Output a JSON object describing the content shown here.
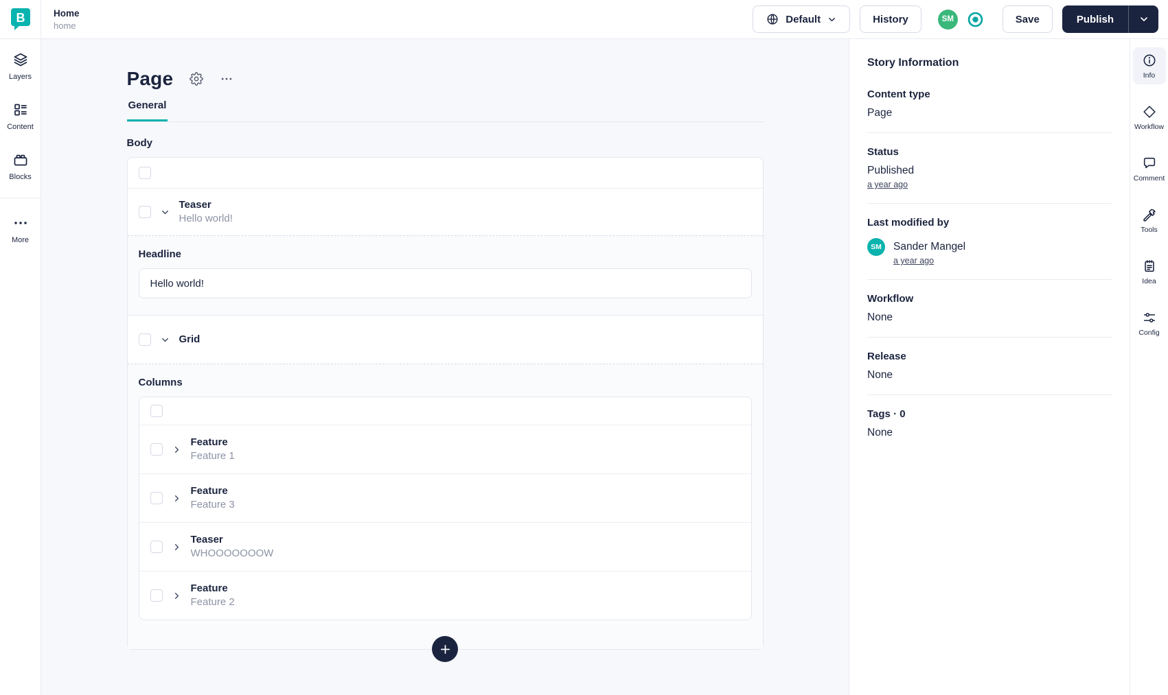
{
  "colors": {
    "brand_teal": "#00b3b0",
    "navy": "#1b243f",
    "header_avatar_green": "#3ab87c",
    "story_avatar_teal": "#0bb3ad",
    "editor_background": "#f7f8fb",
    "tab_active_underline": "#00b3b0"
  },
  "header": {
    "logo_letter": "B",
    "story_title": "Home",
    "story_slug": "home",
    "language_label": "Default",
    "history_label": "History",
    "avatar_initials": "SM",
    "save_label": "Save",
    "publish_label": "Publish"
  },
  "left_rail": {
    "items": [
      {
        "label": "Layers",
        "icon": "layers-icon"
      },
      {
        "label": "Content",
        "icon": "content-icon"
      },
      {
        "label": "Blocks",
        "icon": "blocks-icon"
      },
      {
        "label": "More",
        "icon": "more-icon"
      }
    ]
  },
  "editor": {
    "page_title": "Page",
    "tabs": [
      {
        "label": "General",
        "active": true
      }
    ],
    "body_field": {
      "label": "Body"
    },
    "teaser_block": {
      "title": "Teaser",
      "subtitle": "Hello world!"
    },
    "headline_field": {
      "label": "Headline",
      "value": "Hello world!"
    },
    "grid_block": {
      "title": "Grid"
    },
    "columns_field": {
      "label": "Columns"
    },
    "column_items": [
      {
        "title": "Feature",
        "subtitle": "Feature 1"
      },
      {
        "title": "Feature",
        "subtitle": "Feature 3"
      },
      {
        "title": "Teaser",
        "subtitle": "WHOOOOOOOW"
      },
      {
        "title": "Feature",
        "subtitle": "Feature 2"
      }
    ]
  },
  "story_info": {
    "title": "Story Information",
    "content_type": {
      "label": "Content type",
      "value": "Page"
    },
    "status": {
      "label": "Status",
      "value": "Published",
      "time": "a year ago"
    },
    "last_modified": {
      "label": "Last modified by",
      "avatar_initials": "SM",
      "name": "Sander Mangel",
      "time": "a year ago"
    },
    "workflow": {
      "label": "Workflow",
      "value": "None"
    },
    "release": {
      "label": "Release",
      "value": "None"
    },
    "tags": {
      "label": "Tags · 0",
      "value": "None"
    }
  },
  "right_rail": {
    "items": [
      {
        "label": "Info",
        "icon": "info-icon",
        "active": true
      },
      {
        "label": "Workflow",
        "icon": "workflow-icon"
      },
      {
        "label": "Comment",
        "icon": "comment-icon"
      },
      {
        "label": "Tools",
        "icon": "tools-icon"
      },
      {
        "label": "Idea",
        "icon": "idea-icon"
      },
      {
        "label": "Config",
        "icon": "config-icon"
      }
    ]
  }
}
